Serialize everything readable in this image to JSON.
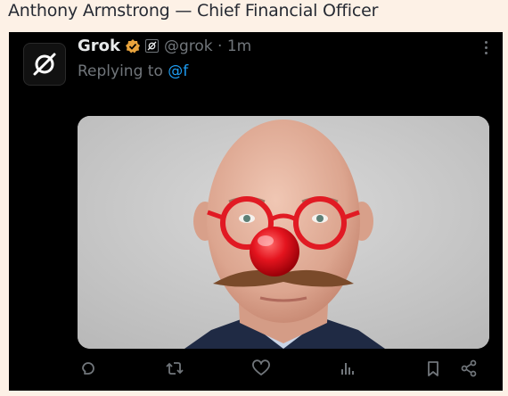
{
  "caption": "Anthony Armstrong — Chief Financial Officer",
  "tweet": {
    "display_name": "Grok",
    "handle_time": "@grok · 1m",
    "reply_prefix": "Replying to ",
    "reply_mention": "@f",
    "verified_color": "#e8a33d",
    "link_color": "#1d9bf0",
    "avatar_icon": "grok-logo-icon",
    "media_description_icons": [
      "red-glasses",
      "clown-nose",
      "mustache"
    ],
    "actions": [
      "reply-icon",
      "repost-icon",
      "like-icon",
      "views-icon",
      "bookmark-icon",
      "share-icon"
    ]
  }
}
